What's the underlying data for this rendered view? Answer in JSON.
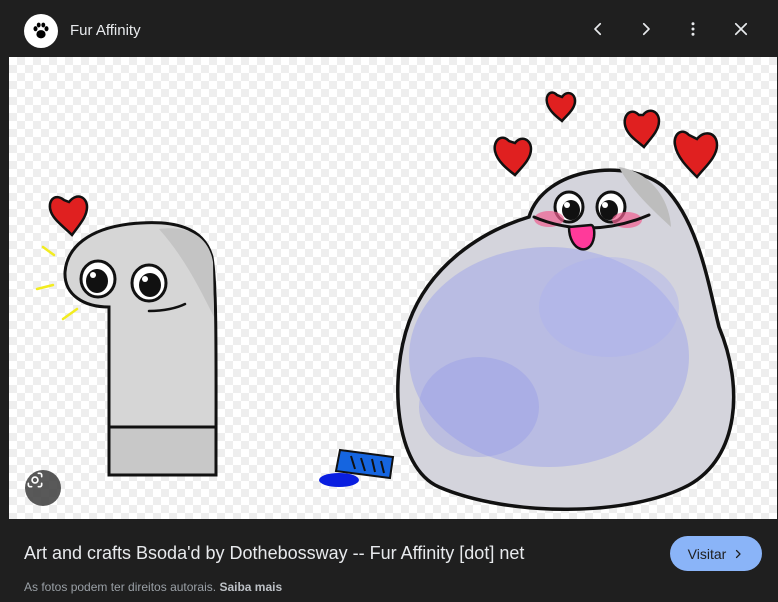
{
  "header": {
    "site_name": "Fur Affinity",
    "logo_icon": "paw-icon",
    "buttons": {
      "previous": "chevron-left-icon",
      "next": "chevron-right-icon",
      "more": "more-vert-icon",
      "close": "close-icon"
    }
  },
  "image": {
    "lens_icon": "lens-icon"
  },
  "footer": {
    "title": "Art and crafts Bsoda'd by Dothebossway -- Fur Affinity [dot] net",
    "visit_label": "Visitar",
    "copyright_notice": "As fotos podem ter direitos autorais.",
    "learn_more": "Saiba mais"
  },
  "colors": {
    "background": "#1f1f1f",
    "accent": "#8ab4f8",
    "text": "#e8eaed",
    "muted": "#9aa0a6"
  }
}
